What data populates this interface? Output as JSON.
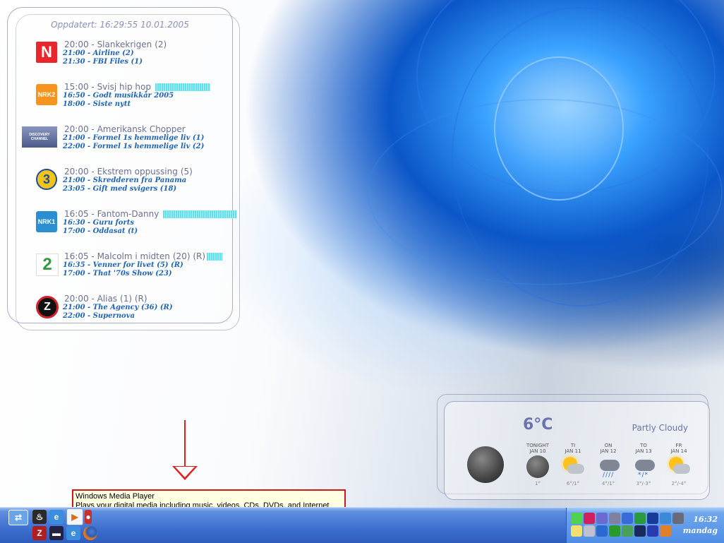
{
  "tv_guide": {
    "updated": "Oppdatert: 16:29:55 10.01.2005",
    "channels": [
      {
        "logo_text": "N",
        "logo_icon": "tvnorge-logo-icon",
        "color": "#e8262c",
        "main_time": "20:00",
        "main_title": "Slankekrigen",
        "main_suffix": "(2)",
        "progress_pct": 0,
        "next": [
          "21:00 - Airline (2)",
          "21:30 - FBI Files (1)"
        ]
      },
      {
        "logo_text": "NRK2",
        "logo_icon": "nrk2-logo-icon",
        "color": "#f7941d",
        "main_time": "15:00",
        "main_title": "Svisj hip hop",
        "main_suffix": "",
        "progress_pct": 100,
        "next": [
          "16:50 - Godt musikkår 2005",
          "18:00 - Siste nytt"
        ]
      },
      {
        "logo_text": "DISCOVERY CHANNEL",
        "logo_icon": "discovery-logo-icon",
        "color": "#6d7aa8",
        "main_time": "20:00",
        "main_title": "Amerikansk Chopper",
        "main_suffix": "",
        "progress_pct": 0,
        "next": [
          "21:00 - Formel 1s hemmelige liv (1)",
          "22:00 - Formel 1s hemmelige liv (2)"
        ]
      },
      {
        "logo_text": "3",
        "logo_icon": "tv3-logo-icon",
        "color": "#f0c419",
        "main_time": "20:00",
        "main_title": "Ekstrem oppussing",
        "main_suffix": "(5)",
        "progress_pct": 0,
        "next": [
          "21:00 - Skredderen fra Panama",
          "23:05 - Gift med svigers (18)"
        ]
      },
      {
        "logo_text": "NRK1",
        "logo_icon": "nrk1-logo-icon",
        "color": "#2a8fd0",
        "main_time": "16:05",
        "main_title": "Fantom-Danny",
        "main_suffix": "",
        "progress_pct": 100,
        "next": [
          "16:30 - Guru forts",
          "17:00 - Oddasat (t)"
        ]
      },
      {
        "logo_text": "2",
        "logo_icon": "tv2-logo-icon",
        "color": "#2e9a3a",
        "main_time": "16:05",
        "main_title": "Malcolm i midten",
        "main_suffix": "(20) (R)",
        "progress_pct": 100,
        "next": [
          "16:35 - Venner for livet (5) (R)",
          "17:00 - That '70s Show (23)"
        ]
      },
      {
        "logo_text": "Z",
        "logo_icon": "tvzebra-logo-icon",
        "color": "#d4202a",
        "main_time": "20:00",
        "main_title": "Alias",
        "main_suffix": "(1) (R)",
        "progress_pct": 0,
        "next": [
          "21:00 - The Agency (36) (R)",
          "22:00 - Supernova"
        ]
      }
    ]
  },
  "weather": {
    "temp": "6°C",
    "condition": "Partly Cloudy",
    "current_icon": "night-cloudy-icon",
    "forecast": [
      {
        "day": "TONIGHT",
        "date": "JAN 10",
        "temps": "1°",
        "icon": "moon-icon"
      },
      {
        "day": "TI",
        "date": "JAN 11",
        "temps": "6°/1°",
        "icon": "partly-sunny-icon"
      },
      {
        "day": "ON",
        "date": "JAN 12",
        "temps": "4°/1°",
        "icon": "rain-icon"
      },
      {
        "day": "TO",
        "date": "JAN 13",
        "temps": "3°/-3°",
        "icon": "snow-showers-icon"
      },
      {
        "day": "FR",
        "date": "JAN 14",
        "temps": "2°/-4°",
        "icon": "partly-sunny-icon"
      }
    ]
  },
  "tooltip": {
    "title": "Windows Media Player",
    "body": "Plays your digital media including music, videos, CDs, DVDs, and Internet Radio."
  },
  "taskbar": {
    "quicklaunch_top": [
      "show-desktop-icon",
      "steam-icon",
      "internet-explorer-icon",
      "windows-media-player-icon",
      "flashget-icon"
    ],
    "quicklaunch_bottom": [
      "filezilla-icon",
      "winamp-icon",
      "internet-explorer-alt-icon",
      "firefox-icon"
    ],
    "tray_icons": [
      "msn-icon",
      "antivirus-icon",
      "network-icon",
      "network-alt-icon",
      "bluetooth-icon",
      "download-icon",
      "quicktime-icon",
      "people-icon",
      "printer-icon",
      "notes-icon",
      "sync-icon",
      "speaker-icon",
      "dap-icon",
      "calc-icon",
      "winamp-tray-icon",
      "word-icon",
      "vlc-icon"
    ],
    "clock_time": "16:32",
    "clock_day": "mandag"
  }
}
